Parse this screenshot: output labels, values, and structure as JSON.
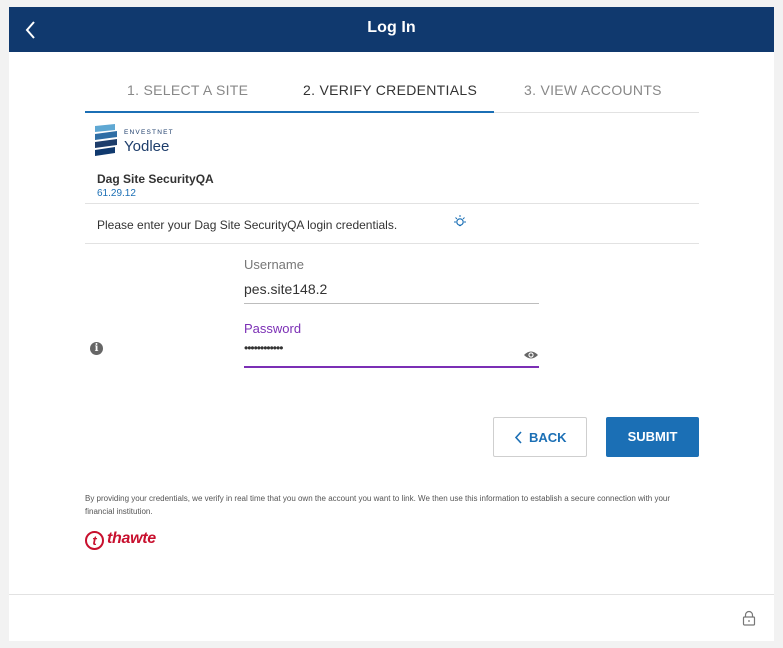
{
  "header": {
    "back_icon": "chevron-left-icon",
    "title": "Log In",
    "background": "#10396e"
  },
  "steps": [
    {
      "label": "1. SELECT A SITE",
      "state": "completed"
    },
    {
      "label": "2. VERIFY CREDENTIALS",
      "state": "active"
    },
    {
      "label": "3. VIEW ACCOUNTS",
      "state": "upcoming"
    }
  ],
  "site": {
    "logo_top": "ENVESTNET",
    "logo_name": "Yodlee",
    "name": "Dag Site SecurityQA",
    "version": "61.29.12"
  },
  "instruction": {
    "text": "Please enter your Dag Site SecurityQA login credentials.",
    "icon": "lightbulb-icon"
  },
  "form": {
    "username": {
      "label": "Username",
      "value": "pes.site148.2"
    },
    "password": {
      "label": "Password",
      "value": "••••••••••••",
      "toggle_icon": "eye-icon"
    },
    "info_icon": "info-icon"
  },
  "buttons": {
    "back_label": "BACK",
    "submit_label": "SUBMIT"
  },
  "disclaimer": "By providing your credentials, we verify in real time that you own the account you want to link. We then use this information to establish a secure connection with your financial institution.",
  "trust_badge": {
    "mark": "t",
    "name": "thawte"
  },
  "footer": {
    "icon": "lock-icon"
  },
  "colors": {
    "accent": "#1b6fb5",
    "focus": "#7b2fb5",
    "brand_red": "#c8102e"
  }
}
